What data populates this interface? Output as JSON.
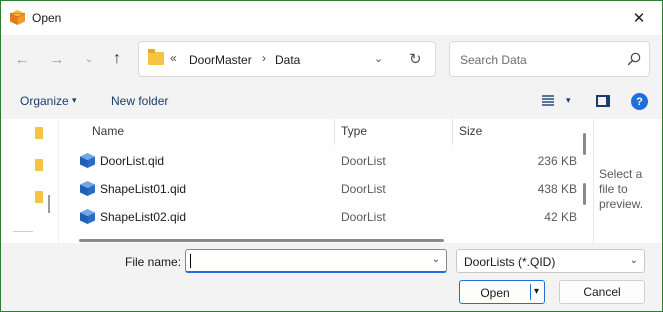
{
  "window": {
    "title": "Open",
    "close_glyph": "✕",
    "app_icon": "box-icon"
  },
  "nav": {
    "back_glyph": "←",
    "forward_glyph": "→",
    "recent_glyph": "⌄",
    "up_glyph": "↑",
    "address": {
      "overflow_glyph": "«",
      "segments": [
        "DoorMaster",
        "Data"
      ],
      "separator_glyph": "›",
      "dropdown_glyph": "⌄",
      "refresh_glyph": "↻"
    },
    "search": {
      "placeholder": "Search Data",
      "value": ""
    }
  },
  "toolbar": {
    "organize_label": "Organize",
    "organize_arrow": "▾",
    "new_folder_label": "New folder",
    "view_arrow": "▾",
    "help_label": "?"
  },
  "filelist": {
    "columns": {
      "name": "Name",
      "type": "Type",
      "size": "Size"
    },
    "rows": [
      {
        "name": "DoorList.qid",
        "type": "DoorList",
        "size": "236 KB",
        "icon": "qid-file-icon"
      },
      {
        "name": "ShapeList01.qid",
        "type": "DoorList",
        "size": "438 KB",
        "icon": "qid-file-icon"
      },
      {
        "name": "ShapeList02.qid",
        "type": "DoorList",
        "size": "42 KB",
        "icon": "qid-file-icon"
      }
    ]
  },
  "preview": {
    "text": "Select a file to preview."
  },
  "bottom": {
    "file_name_label": "File name:",
    "file_name_value": "",
    "file_name_arrow": "⌄",
    "filter_value": "DoorLists (*.QID)",
    "filter_arrow": "⌄",
    "open_label": "Open",
    "open_arrow": "▾",
    "cancel_label": "Cancel"
  },
  "colors": {
    "window_border": "#2f7d32",
    "accent": "#1e6fd9",
    "folder": "#f6c343",
    "file_icon": "#2b6cc4"
  }
}
